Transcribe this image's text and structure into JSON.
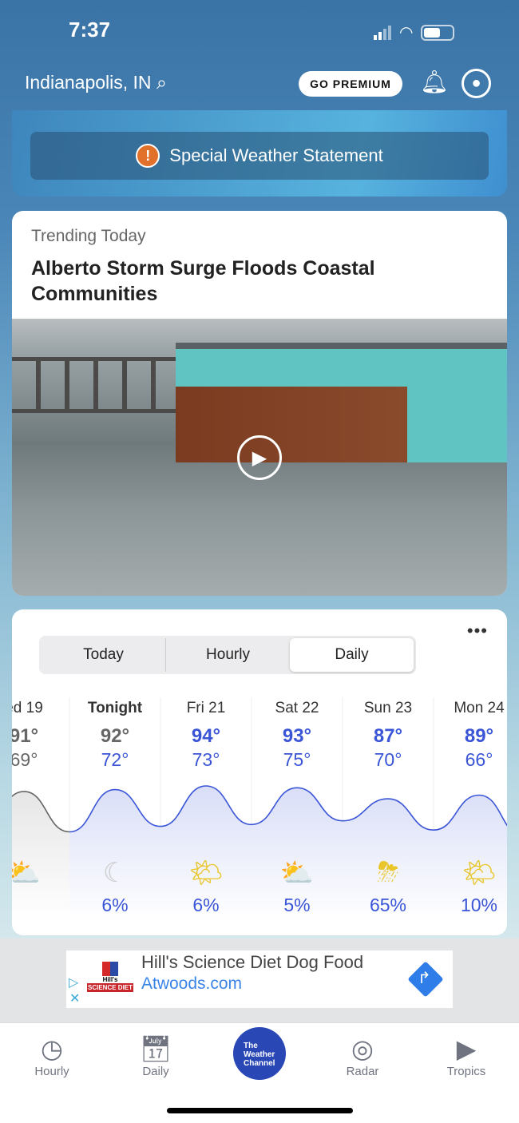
{
  "status": {
    "time": "7:37"
  },
  "header": {
    "location": "Indianapolis, IN",
    "premium": "GO PREMIUM"
  },
  "alert": {
    "label": "Special Weather Statement",
    "color": "#e0702a"
  },
  "trending": {
    "label": "Trending Today",
    "title": "Alberto Storm Surge Floods Coastal Communities"
  },
  "forecast": {
    "tabs": [
      "Today",
      "Hourly",
      "Daily"
    ],
    "selected": "Daily",
    "days": [
      {
        "day": "ed 19",
        "hi": "91°",
        "lo": "69°",
        "hiv": 91,
        "lov": 69,
        "icon": "partly-cloudy",
        "pct": "",
        "past": true
      },
      {
        "day": "Tonight",
        "hi": "92°",
        "lo": "72°",
        "hiv": 92,
        "lov": 72,
        "icon": "moon-cloud",
        "pct": "6%"
      },
      {
        "day": "Fri 21",
        "hi": "94°",
        "lo": "73°",
        "hiv": 94,
        "lov": 73,
        "icon": "mostly-sunny",
        "pct": "6%"
      },
      {
        "day": "Sat 22",
        "hi": "93°",
        "lo": "75°",
        "hiv": 93,
        "lov": 75,
        "icon": "partly-cloudy",
        "pct": "5%"
      },
      {
        "day": "Sun 23",
        "hi": "87°",
        "lo": "70°",
        "hiv": 87,
        "lov": 70,
        "icon": "thunderstorm",
        "pct": "65%"
      },
      {
        "day": "Mon 24",
        "hi": "89°",
        "lo": "66°",
        "hiv": 89,
        "lov": 66,
        "icon": "mostly-sunny",
        "pct": "10%"
      }
    ],
    "accent": "#3a55d6"
  },
  "ad": {
    "title": "Hill's Science Diet Dog Food",
    "domain": "Atwoods.com",
    "logo": "Hill's SCIENCE DIET"
  },
  "nav": [
    {
      "label": "Hourly",
      "icon": "clock-icon"
    },
    {
      "label": "Daily",
      "icon": "calendar-icon"
    },
    {
      "label": "The Weather Channel",
      "icon": "twc-logo"
    },
    {
      "label": "Radar",
      "icon": "radar-icon"
    },
    {
      "label": "Tropics",
      "icon": "play-icon"
    }
  ]
}
